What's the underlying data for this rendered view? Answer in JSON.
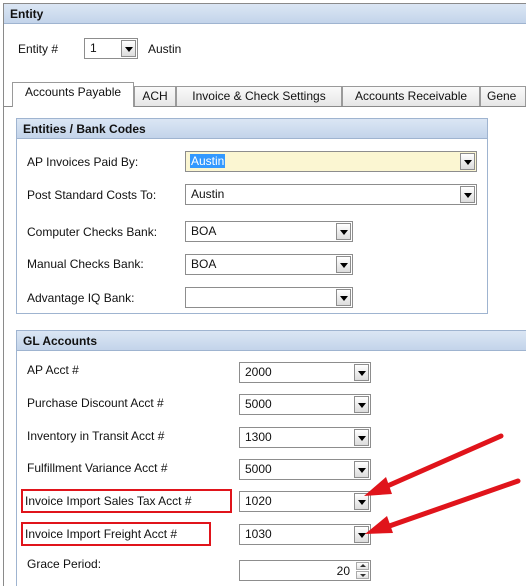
{
  "entity": {
    "section_title": "Entity",
    "number_label": "Entity #",
    "number_value": "1",
    "name_value": "Austin"
  },
  "tabs": [
    {
      "label": "Accounts Payable",
      "active": true
    },
    {
      "label": "ACH",
      "active": false
    },
    {
      "label": "Invoice & Check Settings",
      "active": false
    },
    {
      "label": "Accounts Receivable",
      "active": false
    },
    {
      "label": "Gene",
      "active": false
    }
  ],
  "bank_codes": {
    "section_title": "Entities / Bank Codes",
    "rows": [
      {
        "label": "AP Invoices Paid By:",
        "value": "Austin"
      },
      {
        "label": "Post Standard Costs To:",
        "value": "Austin"
      },
      {
        "label": "Computer Checks Bank:",
        "value": "BOA"
      },
      {
        "label": "Manual Checks Bank:",
        "value": "BOA"
      },
      {
        "label": "Advantage IQ Bank:",
        "value": ""
      }
    ]
  },
  "gl_accounts": {
    "section_title": "GL Accounts",
    "rows": [
      {
        "label": "AP Acct #",
        "value": "2000"
      },
      {
        "label": "Purchase Discount Acct #",
        "value": "5000"
      },
      {
        "label": "Inventory in Transit Acct #",
        "value": "1300"
      },
      {
        "label": "Fulfillment Variance Acct #",
        "value": "5000"
      },
      {
        "label": "Invoice Import Sales Tax Acct #",
        "value": "1020"
      },
      {
        "label": "Invoice Import Freight Acct #",
        "value": "1030"
      }
    ],
    "grace_period_label": "Grace Period:",
    "grace_period_value": "20"
  },
  "colors": {
    "annotation_red": "#e0141b",
    "header_blue": "#c3d4ea",
    "highlight_yellow": "#fbf6d2",
    "selection_blue": "#3399ff"
  }
}
